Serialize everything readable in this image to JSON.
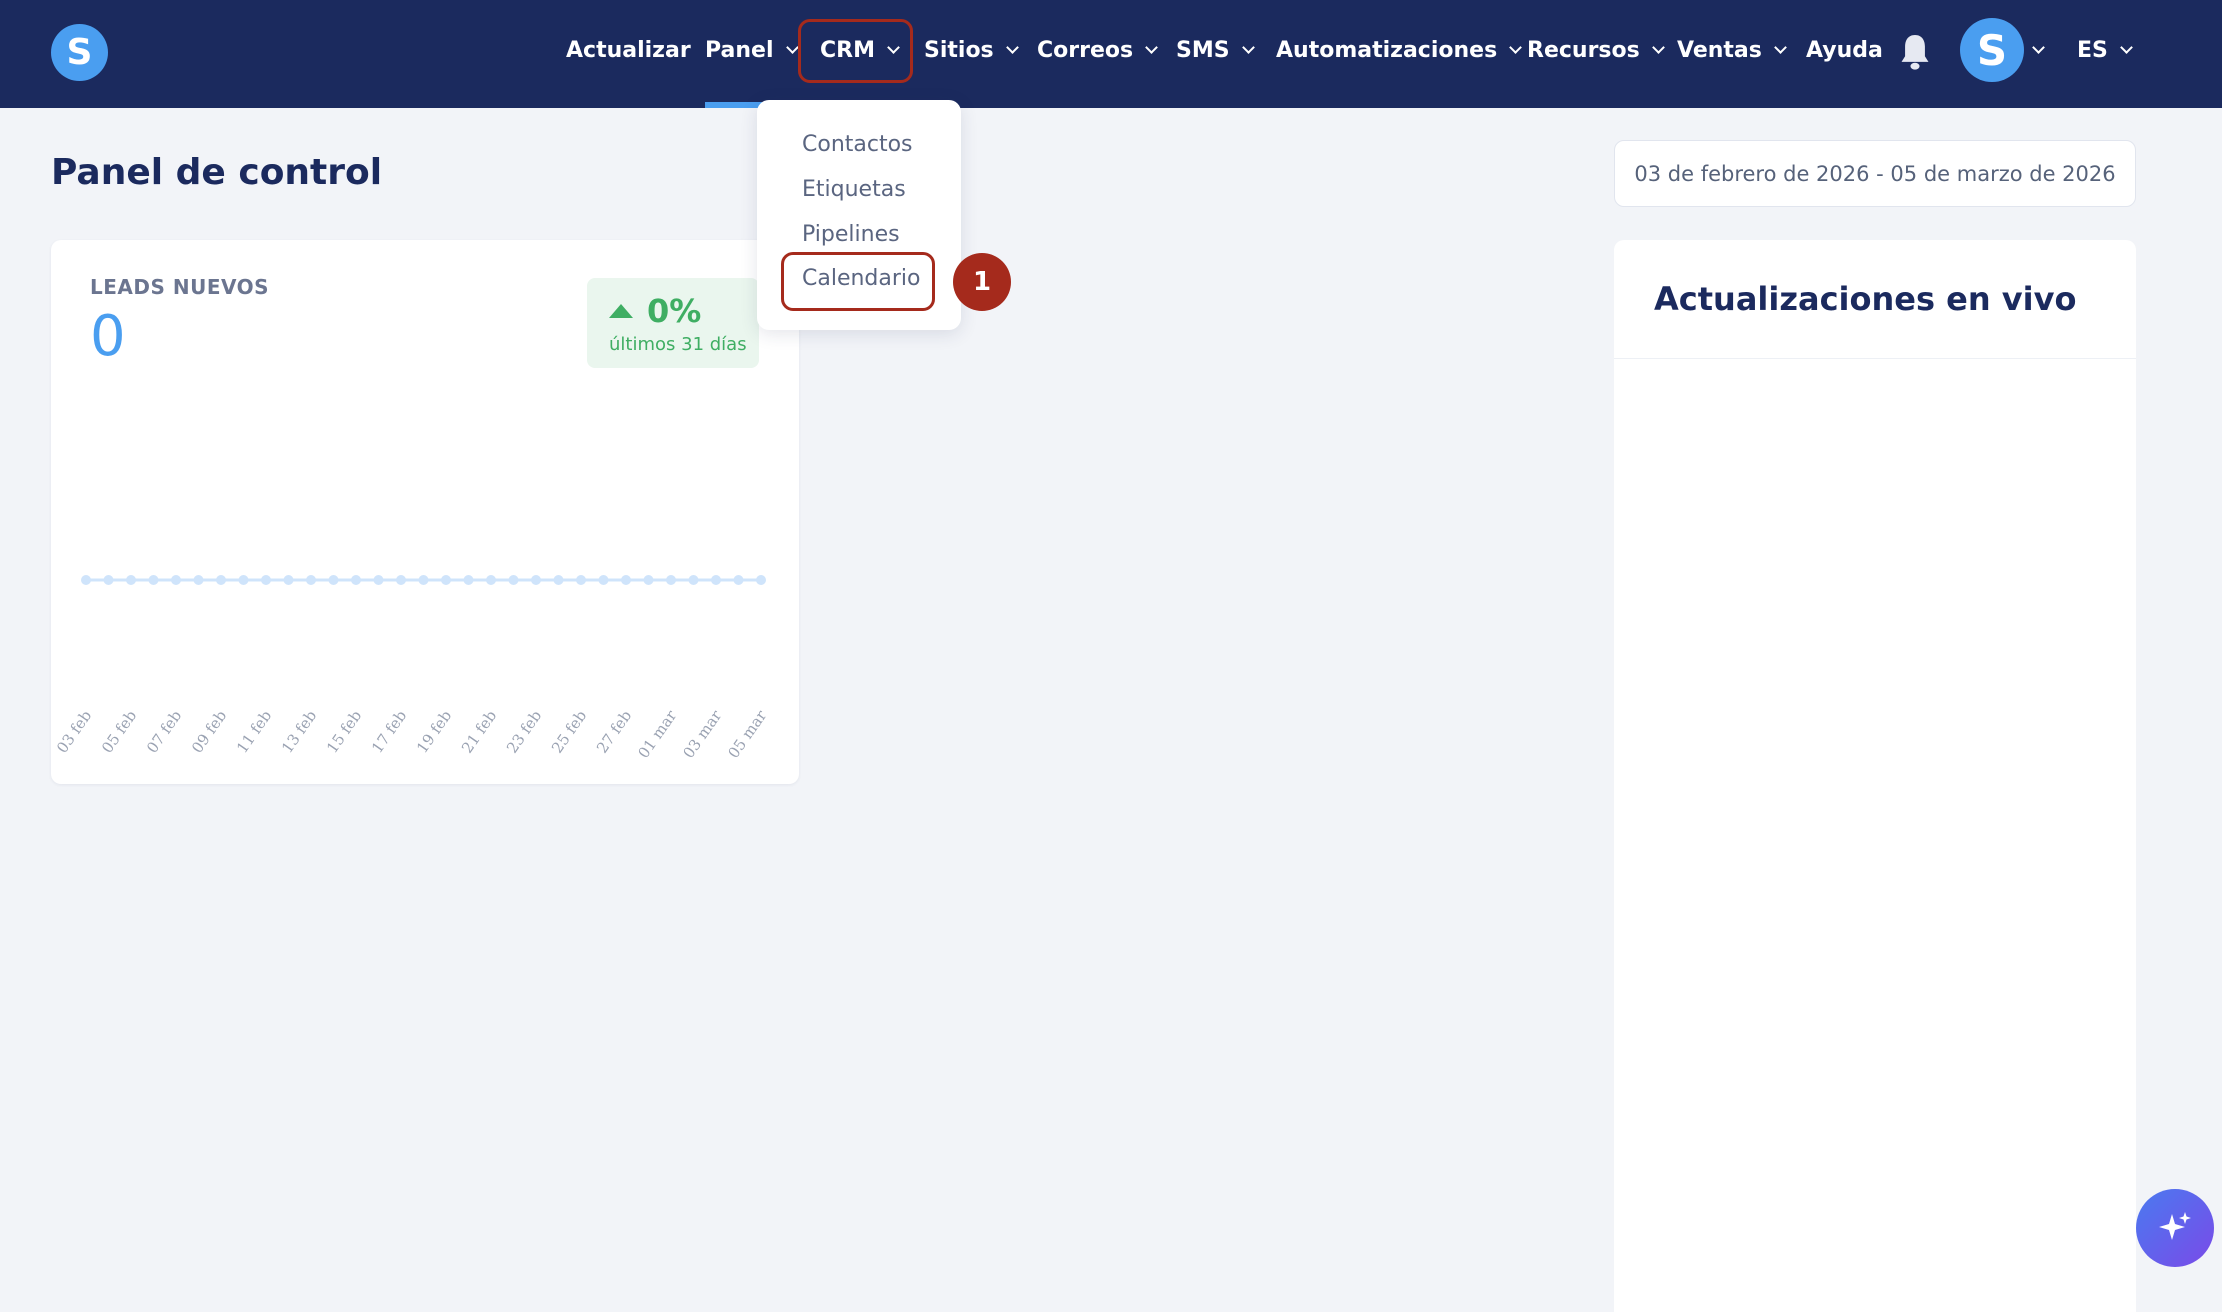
{
  "nav": {
    "logo_letter": "S",
    "items": [
      {
        "label": "Actualizar"
      },
      {
        "label": "Panel"
      },
      {
        "label": "CRM"
      },
      {
        "label": "Sitios"
      },
      {
        "label": "Correos"
      },
      {
        "label": "SMS"
      },
      {
        "label": "Automatizaciones"
      },
      {
        "label": "Recursos"
      },
      {
        "label": "Ventas"
      },
      {
        "label": "Ayuda"
      }
    ],
    "avatar_letter": "S",
    "language": "ES"
  },
  "page": {
    "title": "Panel de control",
    "date_range": "03 de febrero de 2026 - 05 de marzo de 2026"
  },
  "leads": {
    "label": "LEADS NUEVOS",
    "value": "0",
    "change": "0%",
    "change_period": "últimos 31 días"
  },
  "chart_data": {
    "type": "line",
    "x": [
      "03 feb",
      "04 feb",
      "05 feb",
      "06 feb",
      "07 feb",
      "08 feb",
      "09 feb",
      "10 feb",
      "11 feb",
      "12 feb",
      "13 feb",
      "14 feb",
      "15 feb",
      "16 feb",
      "17 feb",
      "18 feb",
      "19 feb",
      "20 feb",
      "21 feb",
      "22 feb",
      "23 feb",
      "24 feb",
      "25 feb",
      "26 feb",
      "27 feb",
      "28 feb",
      "01 mar",
      "02 mar",
      "03 mar",
      "04 mar",
      "05 mar"
    ],
    "values": [
      0,
      0,
      0,
      0,
      0,
      0,
      0,
      0,
      0,
      0,
      0,
      0,
      0,
      0,
      0,
      0,
      0,
      0,
      0,
      0,
      0,
      0,
      0,
      0,
      0,
      0,
      0,
      0,
      0,
      0,
      0
    ],
    "tick_labels": [
      "03 feb",
      "05 feb",
      "07 feb",
      "09 feb",
      "11 feb",
      "13 feb",
      "15 feb",
      "17 feb",
      "19 feb",
      "21 feb",
      "23 feb",
      "25 feb",
      "27 feb",
      "01 mar",
      "03 mar",
      "05 mar"
    ],
    "line_color": "#cfe4fb"
  },
  "live": {
    "title": "Actualizaciones en vivo"
  },
  "crm_menu": {
    "items": [
      {
        "label": "Contactos"
      },
      {
        "label": "Etiquetas"
      },
      {
        "label": "Pipelines"
      },
      {
        "label": "Calendario"
      }
    ],
    "step_number": "1"
  },
  "colors": {
    "nav_bg": "#1b2a5e",
    "accent": "#4a9ef0",
    "success": "#3fae63",
    "highlight": "#a52a1c"
  }
}
